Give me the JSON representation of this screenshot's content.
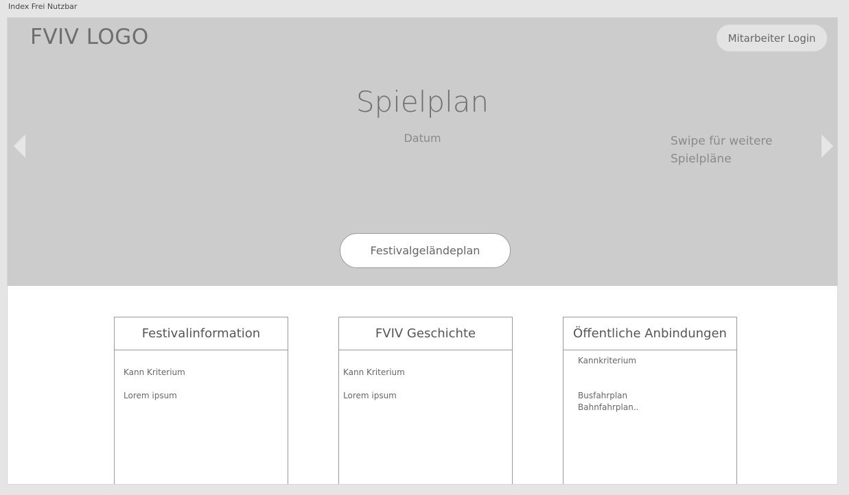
{
  "artboard": {
    "label": "Index Frei Nutzbar"
  },
  "header": {
    "logo": "FVIV LOGO",
    "login_label": "Mitarbeiter Login"
  },
  "hero": {
    "title": "Spielplan",
    "date": "Datum",
    "swipe_hint_line1": "Swipe für weitere",
    "swipe_hint_line2": "Spielpläne",
    "prev_icon": "triangle-left",
    "next_icon": "triangle-right",
    "map_button_label": "Festivalgeländeplan"
  },
  "cards": [
    {
      "title": "Festivalinformation",
      "lines": [
        "Kann Kriterium",
        "Lorem ipsum"
      ]
    },
    {
      "title": "FVIV Geschichte",
      "lines": [
        "Kann Kriterium",
        "Lorem ipsum"
      ]
    },
    {
      "title": "Öffentliche Anbindungen",
      "lines": [
        "Kannkriterium",
        "Busfahrplan",
        "Bahnfahrplan.."
      ]
    }
  ],
  "colors": {
    "hero_background": "#cccccc",
    "page_background": "#ffffff",
    "canvas_background": "#e5e5e5"
  }
}
